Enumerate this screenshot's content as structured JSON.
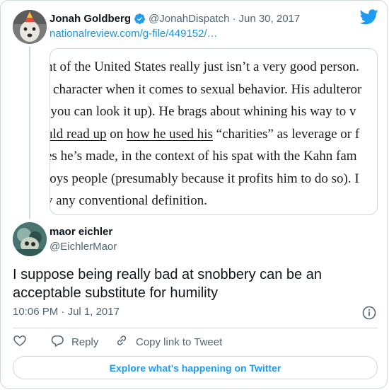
{
  "parent": {
    "name": "Jonah Goldberg",
    "handle": "@JonahDispatch",
    "separator": "·",
    "date": "Jun 30, 2017",
    "link": "nationalreview.com/g-file/449152/…",
    "quote_lines": [
      {
        "text": "nt of the United States really just isn’t a very good person."
      },
      {
        "text": "l character when it comes to sexual behavior. His adulteror"
      },
      {
        "text": " (you can look it up). He brags about whining his way to v"
      },
      {
        "pre": "uld read up",
        "mid": " on ",
        "link": "how he used his",
        "post": " “charities” as leverage or f"
      },
      {
        "text": "es he’s made, in the context of his spat with the Kahn fam"
      },
      {
        "text": "loys people (presumably because it profits him to do so). I"
      },
      {
        "text": "y any conventional definition."
      }
    ]
  },
  "reply": {
    "name": "maor eichler",
    "handle": "@EichlerMaor",
    "text": "I suppose being really bad at snobbery can be an acceptable substitute for humility",
    "time": "10:06 PM",
    "separator": "·",
    "date": "Jul 1, 2017"
  },
  "actions": {
    "reply_label": "Reply",
    "copy_label": "Copy link to Tweet"
  },
  "explore_label": "Explore what's happening on Twitter",
  "colors": {
    "accent": "#1d9bf0",
    "link": "#1b95e0",
    "border": "#cfd9de",
    "secondary_text": "#536471"
  },
  "icons": [
    "verified-badge-icon",
    "twitter-bird-icon",
    "info-icon",
    "heart-icon",
    "reply-bubble-icon",
    "link-icon"
  ]
}
